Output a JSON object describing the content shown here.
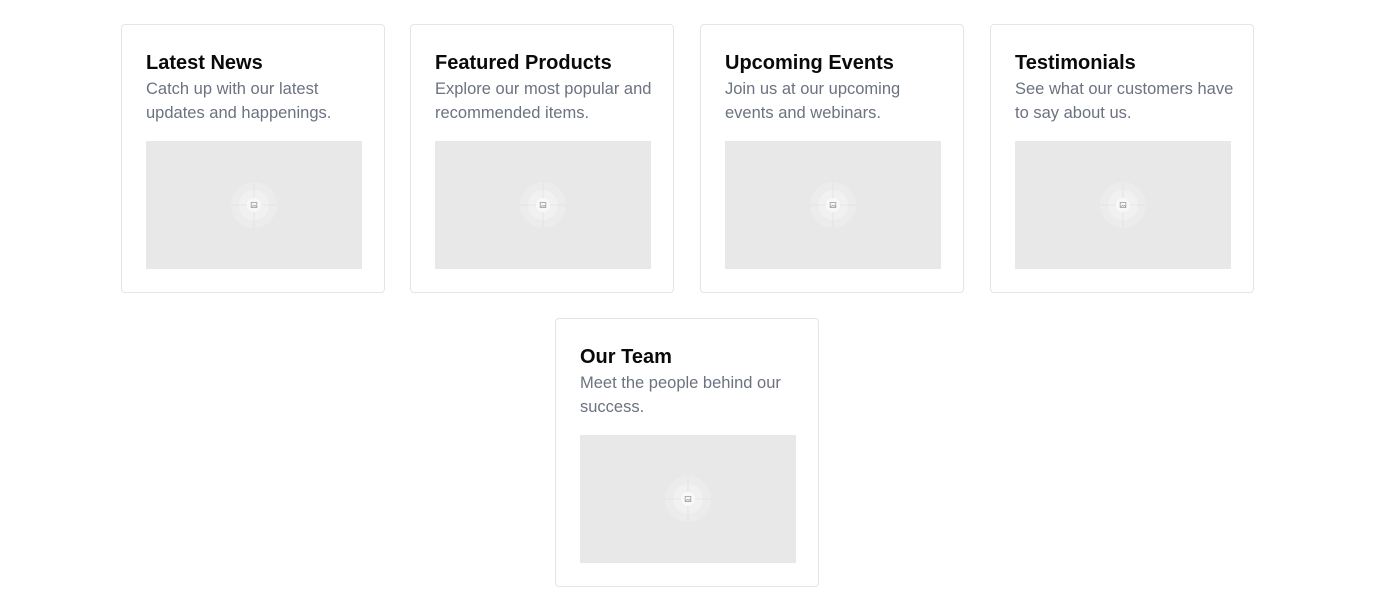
{
  "cards": [
    {
      "title": "Latest News",
      "description": "Catch up with our latest updates and happenings.",
      "image_icon": "image-placeholder-icon"
    },
    {
      "title": "Featured Products",
      "description": "Explore our most popular and recommended items.",
      "image_icon": "image-placeholder-icon"
    },
    {
      "title": "Upcoming Events",
      "description": "Join us at our upcoming events and webinars.",
      "image_icon": "image-placeholder-icon"
    },
    {
      "title": "Testimonials",
      "description": "See what our customers have to say about us.",
      "image_icon": "image-placeholder-icon"
    },
    {
      "title": "Our Team",
      "description": "Meet the people behind our success.",
      "image_icon": "image-placeholder-icon"
    }
  ],
  "colors": {
    "card_border": "#e5e5e5",
    "title": "#0a0a0a",
    "description": "#6b7280",
    "image_placeholder_bg": "#e8e8e8"
  }
}
